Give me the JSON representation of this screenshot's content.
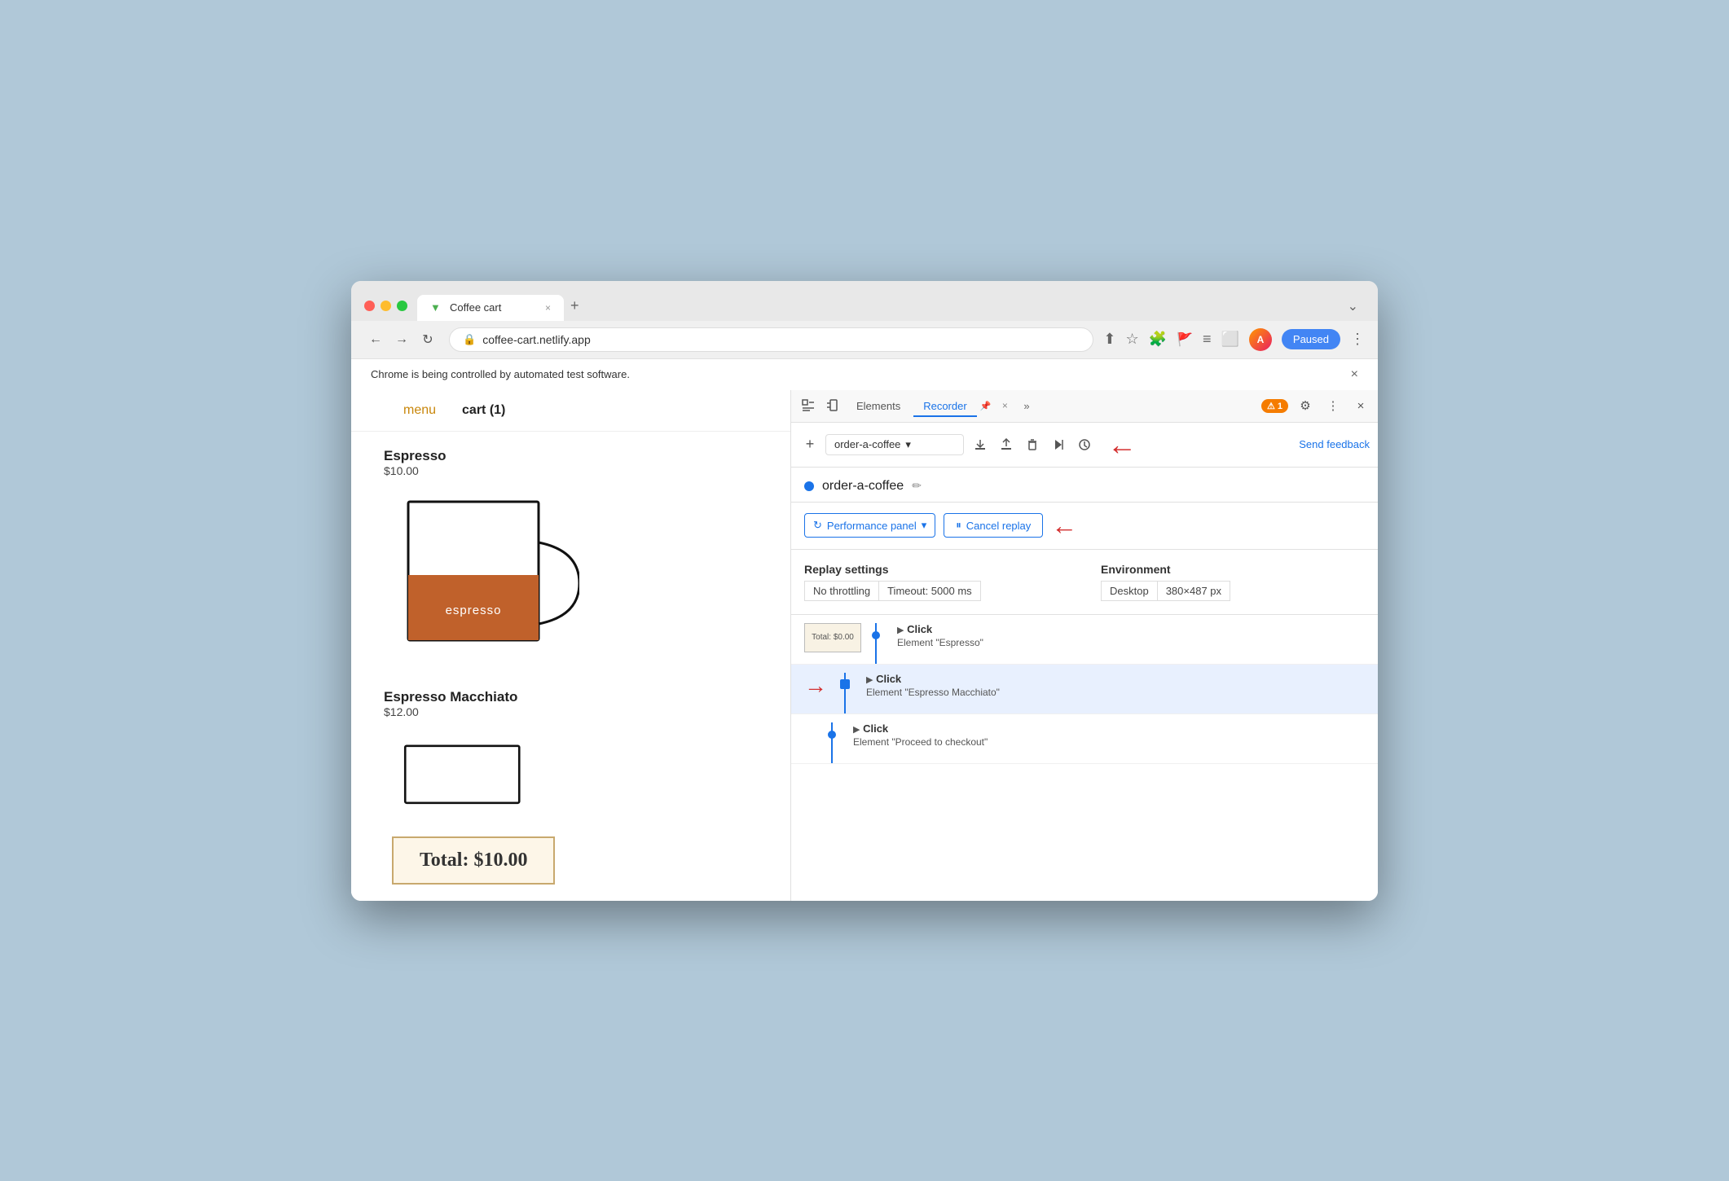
{
  "browser": {
    "tab_title": "Coffee cart",
    "tab_favicon": "▼",
    "url": "coffee-cart.netlify.app",
    "new_tab_label": "+",
    "overflow_label": "⌄",
    "paused_label": "Paused",
    "notification": "Chrome is being controlled by automated test software.",
    "notification_close": "×"
  },
  "nav": {
    "menu_label": "menu",
    "cart_label": "cart (1)"
  },
  "products": [
    {
      "name": "Espresso",
      "price": "$10.00",
      "cup_label": "espresso",
      "has_cup": true
    },
    {
      "name": "Espresso Macchiato",
      "price": "$12.00",
      "has_cup": false
    }
  ],
  "total": {
    "label": "Total: $10.00"
  },
  "devtools": {
    "tab_elements": "Elements",
    "tab_recorder": "Recorder",
    "tab_recorder_pin": "📌",
    "tab_more": "»",
    "badge": "1",
    "send_feedback": "Send feedback",
    "add_label": "+",
    "recording_name": "order-a-coffee",
    "recording_dot_color": "#1a73e8",
    "perf_panel_label": "Performance panel",
    "cancel_replay_label": "Cancel replay",
    "replay_settings_title": "Replay settings",
    "no_throttling": "No throttling",
    "timeout_label": "Timeout: 5000 ms",
    "environment_title": "Environment",
    "desktop_label": "Desktop",
    "viewport_label": "380×487 px",
    "steps": [
      {
        "action": "Click",
        "detail": "Element \"Espresso\"",
        "has_thumbnail": true,
        "thumbnail_text": "Total: $0.00",
        "active": false,
        "dot_shape": "circle"
      },
      {
        "action": "Click",
        "detail": "Element \"Espresso Macchiato\"",
        "has_thumbnail": false,
        "active": true,
        "dot_shape": "square"
      },
      {
        "action": "Click",
        "detail": "Element \"Proceed to checkout\"",
        "has_thumbnail": false,
        "active": false,
        "dot_shape": "circle"
      }
    ]
  }
}
